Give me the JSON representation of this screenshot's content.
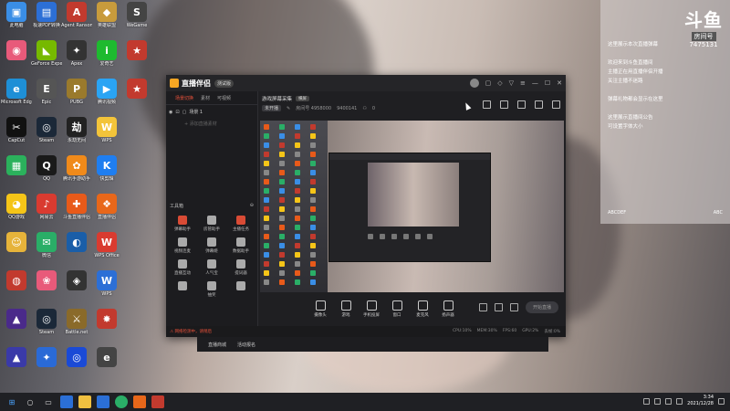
{
  "desktop": {
    "icons": [
      {
        "label": "此电脑",
        "color": "#3a8ee6",
        "glyph": "▣",
        "col": 0,
        "row": 0
      },
      {
        "label": "极速PDF转换",
        "color": "#2c6fd6",
        "glyph": "▤",
        "col": 1,
        "row": 0
      },
      {
        "label": "Agent Ransom",
        "color": "#c23a2e",
        "glyph": "A",
        "col": 2,
        "row": 0
      },
      {
        "label": "英雄联盟",
        "color": "#c89b3c",
        "glyph": "◆",
        "col": 3,
        "row": 0
      },
      {
        "label": "WeGame",
        "color": "#444",
        "glyph": "S",
        "col": 4,
        "row": 0
      },
      {
        "label": "",
        "color": "#e85a7a",
        "glyph": "◉",
        "col": 0,
        "row": 1
      },
      {
        "label": "GeForce Experience",
        "color": "#76b900",
        "glyph": "◣",
        "col": 1,
        "row": 1
      },
      {
        "label": "Apex",
        "color": "#333",
        "glyph": "✦",
        "col": 2,
        "row": 1
      },
      {
        "label": "爱奇艺",
        "color": "#1eba2f",
        "glyph": "i",
        "col": 3,
        "row": 1
      },
      {
        "label": "",
        "color": "#c23a2e",
        "glyph": "★",
        "col": 4,
        "row": 1
      },
      {
        "label": "Microsoft Edge",
        "color": "#1e8fd6",
        "glyph": "e",
        "col": 0,
        "row": 2
      },
      {
        "label": "Epic",
        "color": "#555",
        "glyph": "E",
        "col": 1,
        "row": 2
      },
      {
        "label": "PUBG",
        "color": "#9a7a2c",
        "glyph": "P",
        "col": 2,
        "row": 2
      },
      {
        "label": "腾讯视频",
        "color": "#2aa4f4",
        "glyph": "▶",
        "col": 3,
        "row": 2
      },
      {
        "label": "",
        "color": "#c23a2e",
        "glyph": "★",
        "col": 4,
        "row": 2
      },
      {
        "label": "CapCut",
        "color": "#111",
        "glyph": "✂",
        "col": 0,
        "row": 3
      },
      {
        "label": "Steam",
        "color": "#1b2838",
        "glyph": "◎",
        "col": 1,
        "row": 3
      },
      {
        "label": "永劫无间",
        "color": "#222",
        "glyph": "劫",
        "col": 2,
        "row": 3
      },
      {
        "label": "WPS",
        "color": "#f3c43a",
        "glyph": "W",
        "col": 3,
        "row": 3
      },
      {
        "label": "",
        "color": "#2bb15c",
        "glyph": "▦",
        "col": 0,
        "row": 4
      },
      {
        "label": "QQ",
        "color": "#1a1a1a",
        "glyph": "Q",
        "col": 1,
        "row": 4
      },
      {
        "label": "腾讯手游助手",
        "color": "#f08a1a",
        "glyph": "✿",
        "col": 2,
        "row": 4
      },
      {
        "label": "快剪辑",
        "color": "#1f7ef0",
        "glyph": "K",
        "col": 3,
        "row": 4
      },
      {
        "label": "QQ游戏",
        "color": "#f5c518",
        "glyph": "◕",
        "col": 0,
        "row": 5
      },
      {
        "label": "网易云",
        "color": "#d93b30",
        "glyph": "♪",
        "col": 1,
        "row": 5
      },
      {
        "label": "斗鱼直播伴侣",
        "color": "#e85a1a",
        "glyph": "✚",
        "col": 2,
        "row": 5
      },
      {
        "label": "直播伴侣",
        "color": "#e8671a",
        "glyph": "❖",
        "col": 3,
        "row": 5
      },
      {
        "label": "",
        "color": "#e6b33a",
        "glyph": "☺",
        "col": 0,
        "row": 6
      },
      {
        "label": "微信",
        "color": "#2aae67",
        "glyph": "✉",
        "col": 1,
        "row": 6
      },
      {
        "label": "",
        "color": "#1a5ea8",
        "glyph": "◐",
        "col": 2,
        "row": 6
      },
      {
        "label": "WPS Office",
        "color": "#d93b30",
        "glyph": "W",
        "col": 3,
        "row": 6
      },
      {
        "label": "",
        "color": "#c23a2e",
        "glyph": "◍",
        "col": 0,
        "row": 7
      },
      {
        "label": "",
        "color": "#e85a7a",
        "glyph": "❀",
        "col": 1,
        "row": 7
      },
      {
        "label": "",
        "color": "#333",
        "glyph": "◈",
        "col": 2,
        "row": 7
      },
      {
        "label": "WPS",
        "color": "#2c6fd6",
        "glyph": "W",
        "col": 3,
        "row": 7
      },
      {
        "label": "",
        "color": "#4a2a8a",
        "glyph": "▲",
        "col": 0,
        "row": 8
      },
      {
        "label": "Steam",
        "color": "#1b2838",
        "glyph": "◎",
        "col": 1,
        "row": 8
      },
      {
        "label": "Battle.net",
        "color": "#8a6a2a",
        "glyph": "⚔",
        "col": 2,
        "row": 8
      },
      {
        "label": "",
        "color": "#c23a2e",
        "glyph": "✸",
        "col": 3,
        "row": 8
      },
      {
        "label": "",
        "color": "#3a3aa8",
        "glyph": "▲",
        "col": 0,
        "row": 9
      },
      {
        "label": "",
        "color": "#2a6ad6",
        "glyph": "✦",
        "col": 1,
        "row": 9
      },
      {
        "label": "",
        "color": "#1a4ad6",
        "glyph": "◎",
        "col": 2,
        "row": 9
      },
      {
        "label": "",
        "color": "#444",
        "glyph": "e",
        "col": 3,
        "row": 9
      }
    ]
  },
  "side_panel": {
    "logo_big": "斗鱼",
    "logo_small": "房间号",
    "room_number": "7475131",
    "lines": [
      "这里展示本次直播弹幕",
      "",
      "欢迎来到斗鱼直播间",
      "主播正在用直播伴侣开播",
      "关注主播不迷路",
      "",
      "弹幕礼物都会显示在这里",
      "",
      "这里展示直播间公告",
      "可设置字体大小"
    ],
    "footer_left": "ABCDEF",
    "footer_right": "ABC"
  },
  "app": {
    "name": "直播伴侣",
    "version": "测试版",
    "left_tabs": [
      "场景切换",
      "素材",
      "可视频"
    ],
    "scene_name": "场景 1",
    "scene_add": "+ 添加直播素材",
    "tools_header": "工具箱",
    "tools": [
      {
        "label": "弹幕助手",
        "red": true
      },
      {
        "label": "房管助手",
        "red": false
      },
      {
        "label": "主播任务",
        "red": true
      },
      {
        "label": "视频连麦",
        "red": false
      },
      {
        "label": "弹幕姬",
        "red": false
      },
      {
        "label": "数据助手",
        "red": false
      },
      {
        "label": "直播互动",
        "red": false
      },
      {
        "label": "人气宝",
        "red": false
      },
      {
        "label": "提词器",
        "red": false
      },
      {
        "label": "",
        "red": false
      },
      {
        "label": "抽奖",
        "red": false
      },
      {
        "label": "",
        "red": false
      }
    ],
    "main_title": "游戏屏幕采集",
    "main_tag": "横屏",
    "sub_pill": "未开播",
    "sub_room": "房间号 4958000",
    "sub_id": "9400141",
    "sub_count": "0",
    "bottom_tools": [
      "摄像头",
      "游戏",
      "手机投屏",
      "窗口",
      "麦克风",
      "扬声器"
    ],
    "start_label": "开始直播",
    "status_warn": "⚠ 网络检测中，请稍后",
    "status_right": [
      "CPU:10%",
      "MEM:30%",
      "FPS:60",
      "GPU:2%",
      "丢帧:0%"
    ]
  },
  "lower_menu": [
    "直播商城",
    "活动报名"
  ],
  "taskbar": {
    "time": "3:34",
    "date": "2021/12/28"
  }
}
